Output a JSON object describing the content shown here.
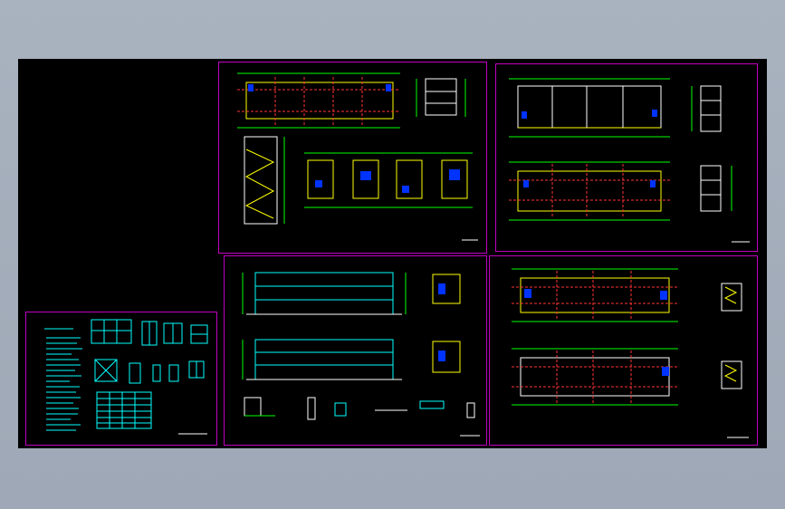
{
  "viewer": {
    "background_color": "#a4adba",
    "canvas_color": "#000000",
    "frame_color": "#c000c0"
  },
  "sheets": [
    {
      "id": "sheet-door-window-schedule",
      "content": [
        "door-window-elevations",
        "schedule-table",
        "notes-text"
      ]
    },
    {
      "id": "sheet-floor-plan-stair-details",
      "content": [
        "floor-plan",
        "section",
        "stair-section",
        "toilet-plans"
      ]
    },
    {
      "id": "sheet-floor-plans-upper",
      "content": [
        "floor-plan",
        "floor-plan",
        "side-elevations"
      ]
    },
    {
      "id": "sheet-elevations-details",
      "content": [
        "front-elevation",
        "rear-elevation",
        "toilet-details",
        "construction-details"
      ]
    },
    {
      "id": "sheet-roof-plans",
      "content": [
        "roof-plan",
        "floor-plan",
        "toilet-details"
      ]
    }
  ],
  "drawing_colors": {
    "line": "#ffffff",
    "axis": "#ff3333",
    "dim": "#00ff00",
    "wall": "#ffff00",
    "text": "#00ffff",
    "fixture": "#0033ff"
  }
}
